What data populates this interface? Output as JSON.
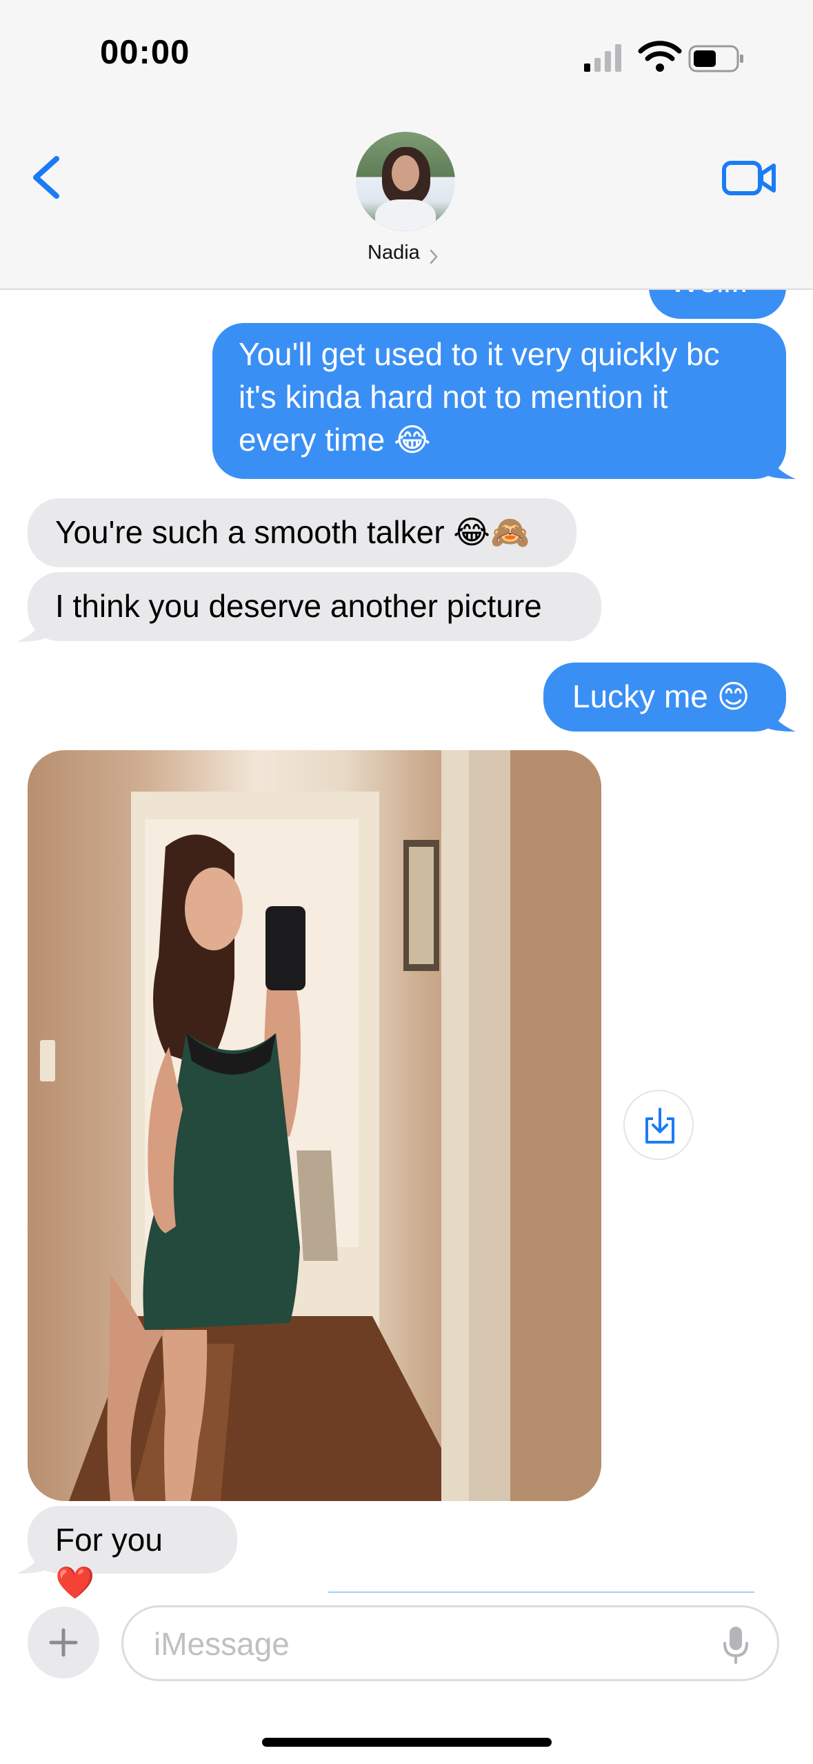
{
  "status_bar": {
    "time": "00:00"
  },
  "header": {
    "contact_name": "Nadia"
  },
  "messages": [
    {
      "side": "sent",
      "text": "Well..",
      "cut_off": true
    },
    {
      "side": "sent",
      "text": "You'll get used to it very quickly bc\nit's kinda hard not to mention it\nevery time 😂"
    },
    {
      "side": "received",
      "text": "You're such a smooth talker 😂🙈"
    },
    {
      "side": "received",
      "text": "I think you deserve another picture"
    },
    {
      "side": "sent",
      "text": "Lucky me 😊"
    },
    {
      "side": "received",
      "type": "photo",
      "alt": "photo"
    },
    {
      "side": "received",
      "text": "For you ❤️"
    }
  ],
  "input": {
    "placeholder": "iMessage"
  },
  "icons": {
    "back": "chevron-left-icon",
    "video": "video-camera-icon",
    "save": "download-icon",
    "plus": "plus-icon",
    "mic": "microphone-icon"
  },
  "colors": {
    "sent_bubble": "#3a8ff5",
    "received_bubble": "#e9e9eb",
    "accent": "#1a7cf5"
  }
}
